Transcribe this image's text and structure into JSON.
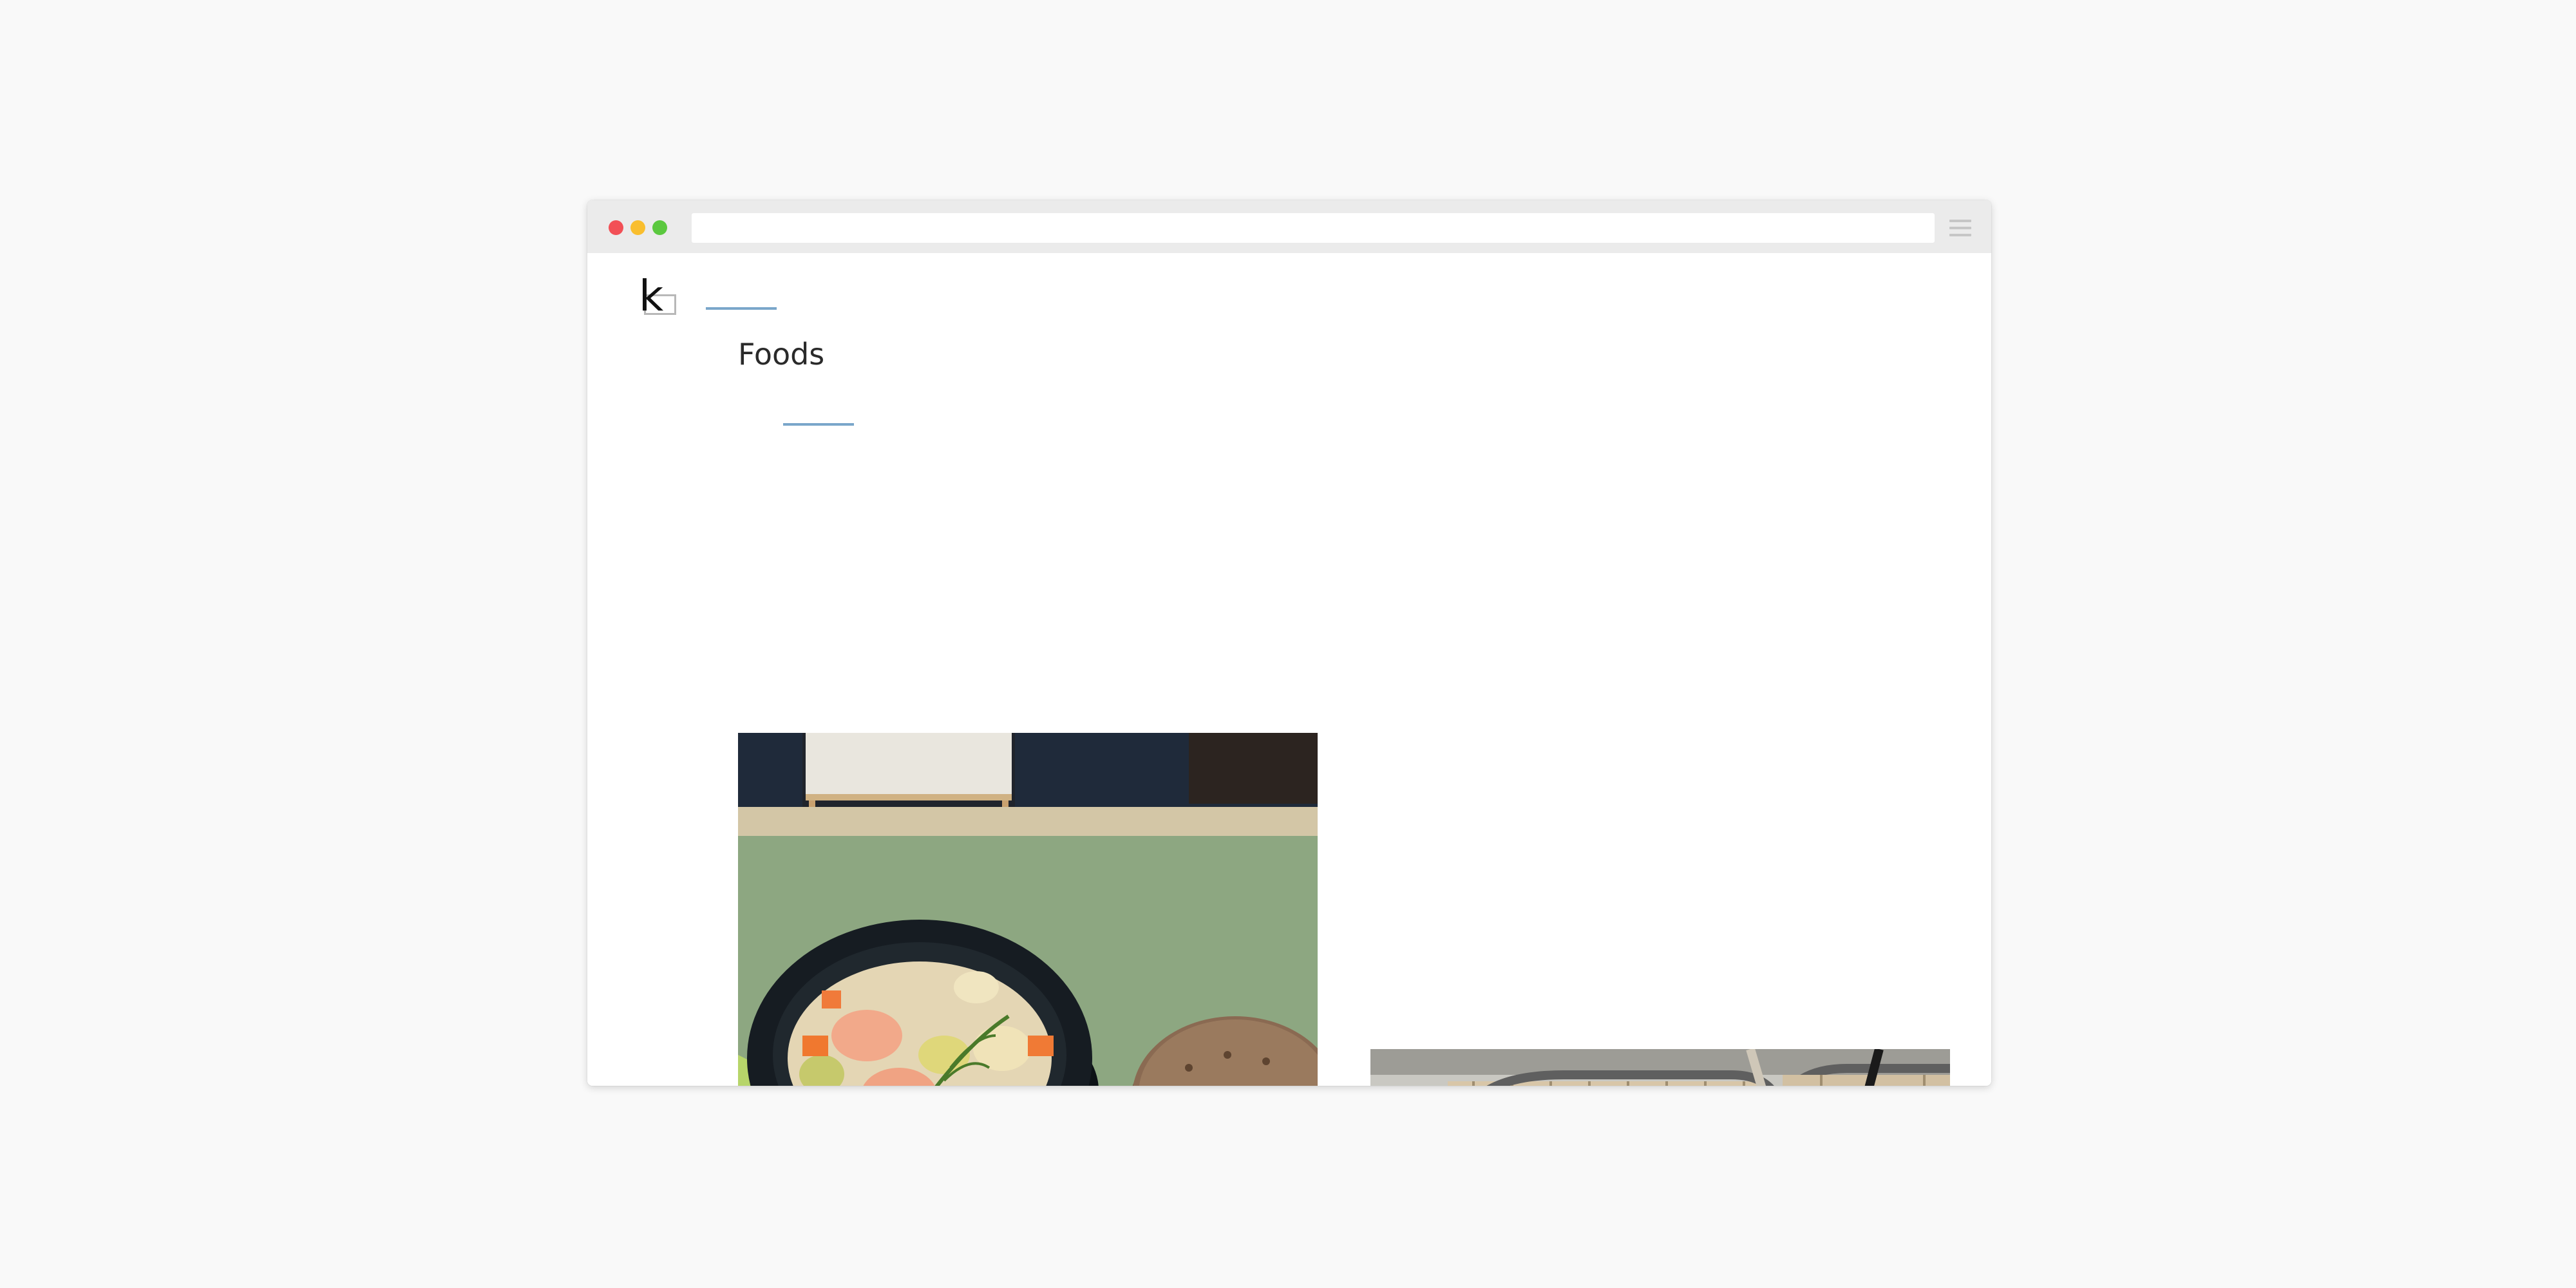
{
  "browser": {
    "address": "",
    "menu_icon": "hamburger-menu-icon",
    "traffic_lights": [
      "#f25056",
      "#f9be2e",
      "#5bc83f"
    ]
  },
  "site": {
    "logo_letter": "k",
    "accent_color": "#7aa6ca"
  },
  "page": {
    "title": "Foods"
  },
  "gallery": {
    "items": [
      {
        "name": "soup-with-bread-photo"
      },
      {
        "name": "iced-coffee-photo"
      }
    ]
  }
}
